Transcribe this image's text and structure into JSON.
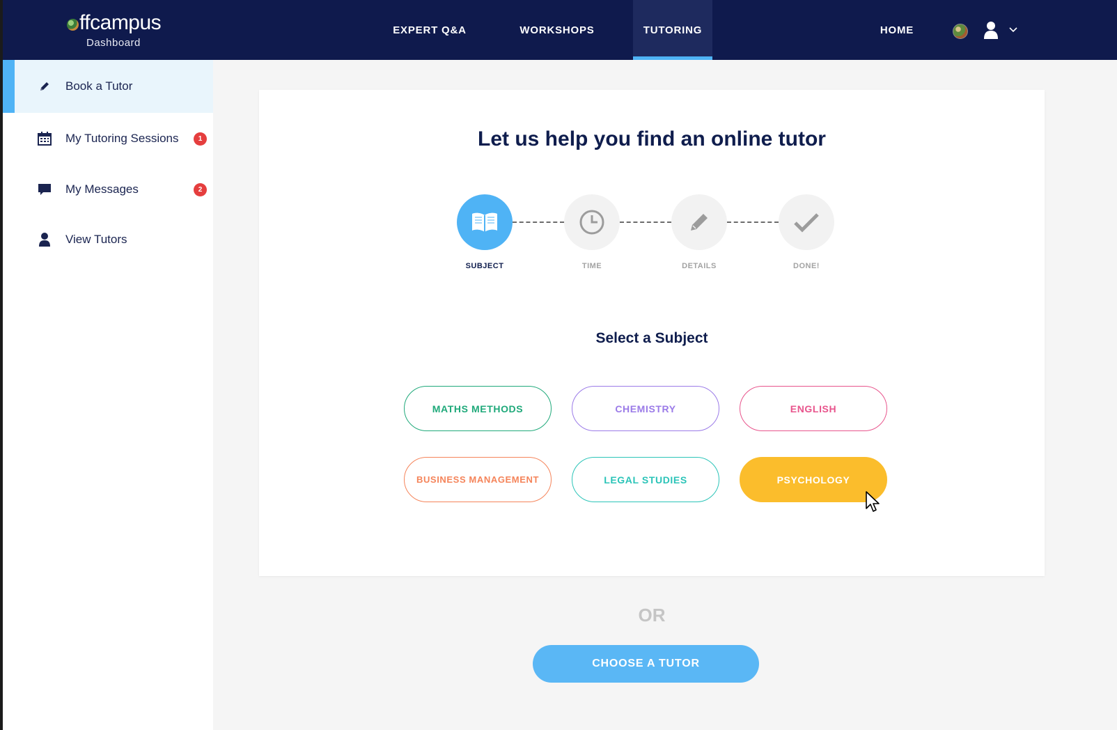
{
  "header": {
    "logo": {
      "text": "ffcampus",
      "subtitle": "Dashboard"
    },
    "nav": [
      {
        "label": "EXPERT Q&A",
        "active": false
      },
      {
        "label": "WORKSHOPS",
        "active": false
      },
      {
        "label": "TUTORING",
        "active": true
      },
      {
        "label": "HOME",
        "active": false
      }
    ],
    "icons": [
      "globe-icon",
      "user-icon",
      "chevron-down-icon"
    ]
  },
  "sidebar": {
    "items": [
      {
        "label": "Book a Tutor",
        "icon": "pencil-icon",
        "active": true,
        "badge": ""
      },
      {
        "label": "My Tutoring Sessions",
        "icon": "calendar-icon",
        "active": false,
        "badge": "1"
      },
      {
        "label": "My Messages",
        "icon": "chat-bubble-icon",
        "active": false,
        "badge": "2"
      },
      {
        "label": "View Tutors",
        "icon": "user-icon",
        "active": false,
        "badge": ""
      }
    ]
  },
  "main": {
    "title": "Let us help you find an online tutor",
    "steps": [
      {
        "label": "SUBJECT",
        "icon": "book-icon",
        "active": true
      },
      {
        "label": "TIME",
        "icon": "clock-icon",
        "active": false
      },
      {
        "label": "DETAILS",
        "icon": "pencil-icon",
        "active": false
      },
      {
        "label": "DONE!",
        "icon": "check-icon",
        "active": false
      }
    ],
    "subtitle": "Select a Subject",
    "subjects": [
      {
        "label": "MATHS METHODS",
        "color": "#1fa97a",
        "selected": false
      },
      {
        "label": "CHEMISTRY",
        "color": "#9b7be8",
        "selected": false
      },
      {
        "label": "ENGLISH",
        "color": "#e8548c",
        "selected": false
      },
      {
        "label": "BUSINESS MANAGEMENT",
        "color": "#f5845a",
        "selected": false
      },
      {
        "label": "LEGAL STUDIES",
        "color": "#2bc4b8",
        "selected": false
      },
      {
        "label": "PSYCHOLOGY",
        "color": "#fbbd2c",
        "selected": true
      }
    ],
    "or_label": "OR",
    "choose_button": "CHOOSE A TUTOR"
  },
  "colors": {
    "navy": "#0f1a4d",
    "accent_blue": "#4fb3f5",
    "badge_red": "#e53e3e"
  }
}
